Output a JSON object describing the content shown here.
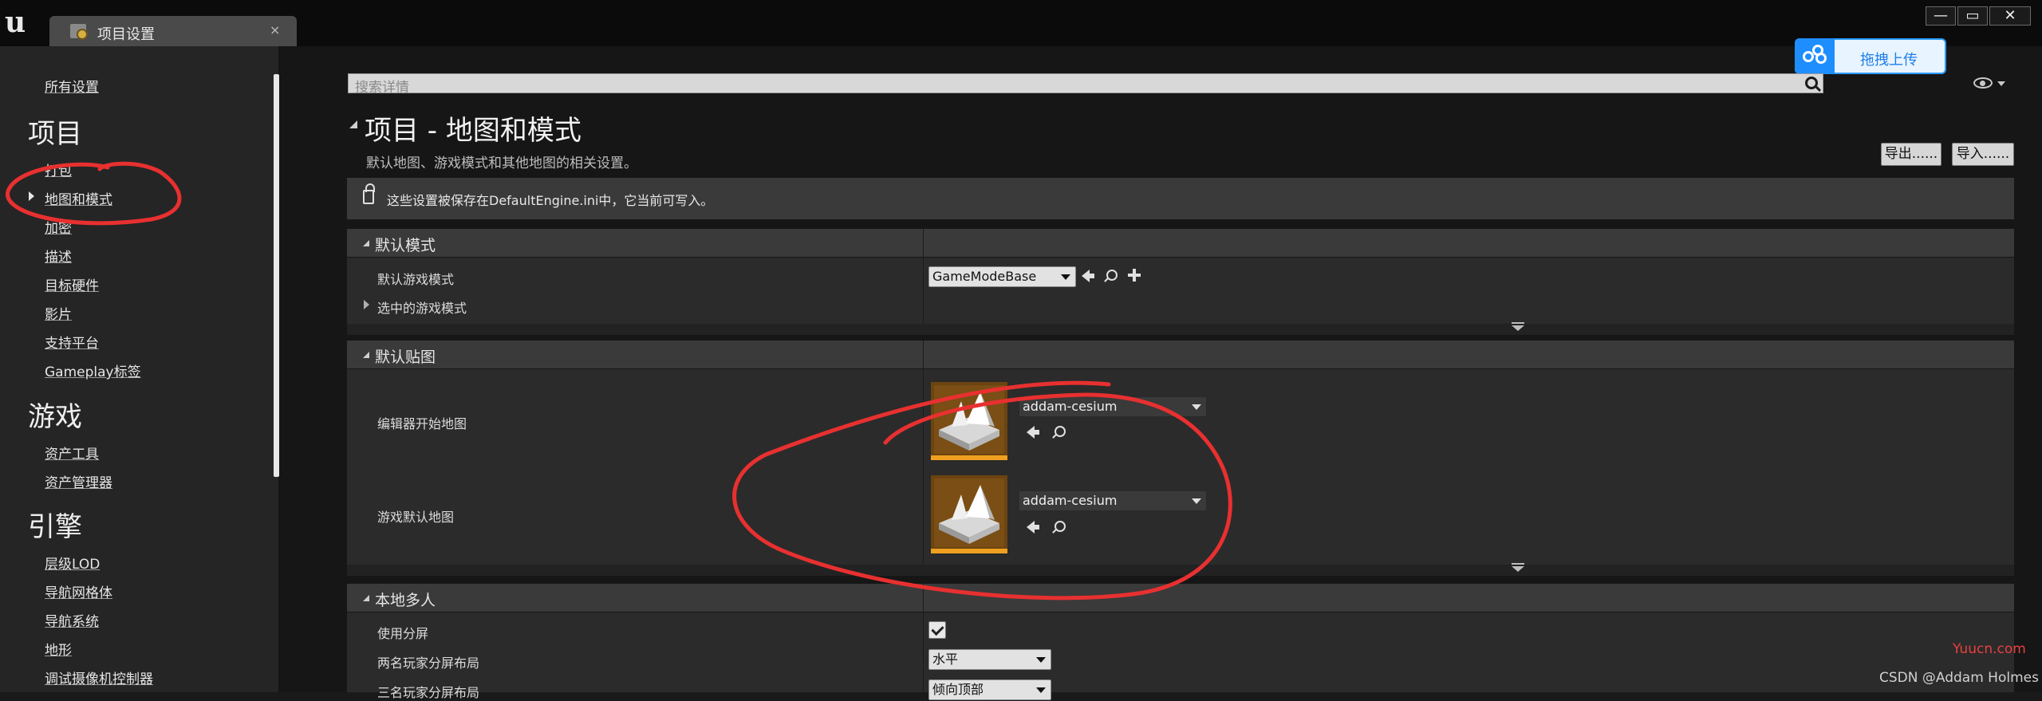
{
  "window": {
    "tab_title": "项目设置",
    "tab_close": "×",
    "min": "—",
    "max": "▭",
    "close": "✕"
  },
  "sidebar": {
    "all_settings": "所有设置",
    "groups": [
      {
        "heading": "项目",
        "items": [
          "打包",
          "地图和模式",
          "加密",
          "描述",
          "目标硬件",
          "影片",
          "支持平台",
          "Gameplay标签"
        ]
      },
      {
        "heading": "游戏",
        "items": [
          "资产工具",
          "资产管理器"
        ]
      },
      {
        "heading": "引擎",
        "items": [
          "层级LOD",
          "导航网格体",
          "导航系统",
          "地形",
          "调试摄像机控制器"
        ]
      }
    ],
    "selected": "地图和模式"
  },
  "search": {
    "placeholder": "搜索详情"
  },
  "upload": {
    "label": "拖拽上传"
  },
  "page": {
    "title": "项目 - 地图和模式",
    "description": "默认地图、游戏模式和其他地图的相关设置。",
    "export_label": "导出......",
    "import_label": "导入......",
    "notice": "这些设置被保存在DefaultEngine.ini中，它当前可写入。"
  },
  "sections": {
    "default_modes": {
      "label": "默认模式",
      "default_game_mode_label": "默认游戏模式",
      "default_game_mode_value": "GameModeBase",
      "selected_game_mode_label": "选中的游戏模式"
    },
    "default_maps": {
      "label": "默认贴图",
      "editor_startup_map_label": "编辑器开始地图",
      "editor_startup_map_value": "addam-cesium",
      "game_default_map_label": "游戏默认地图",
      "game_default_map_value": "addam-cesium"
    },
    "local_multiplayer": {
      "label": "本地多人",
      "use_splitscreen_label": "使用分屏",
      "use_splitscreen_checked": true,
      "two_player_layout_label": "两名玩家分屏布局",
      "two_player_layout_value": "水平",
      "three_player_layout_label": "三名玩家分屏布局",
      "three_player_layout_value": "倾向顶部"
    }
  },
  "watermarks": {
    "site": "Yuucn.com",
    "author": "CSDN @Addam Holmes"
  },
  "colors": {
    "annotation": "#e83030",
    "upload_accent": "#1e8eff",
    "thumbnail_bar": "#f0a020"
  }
}
